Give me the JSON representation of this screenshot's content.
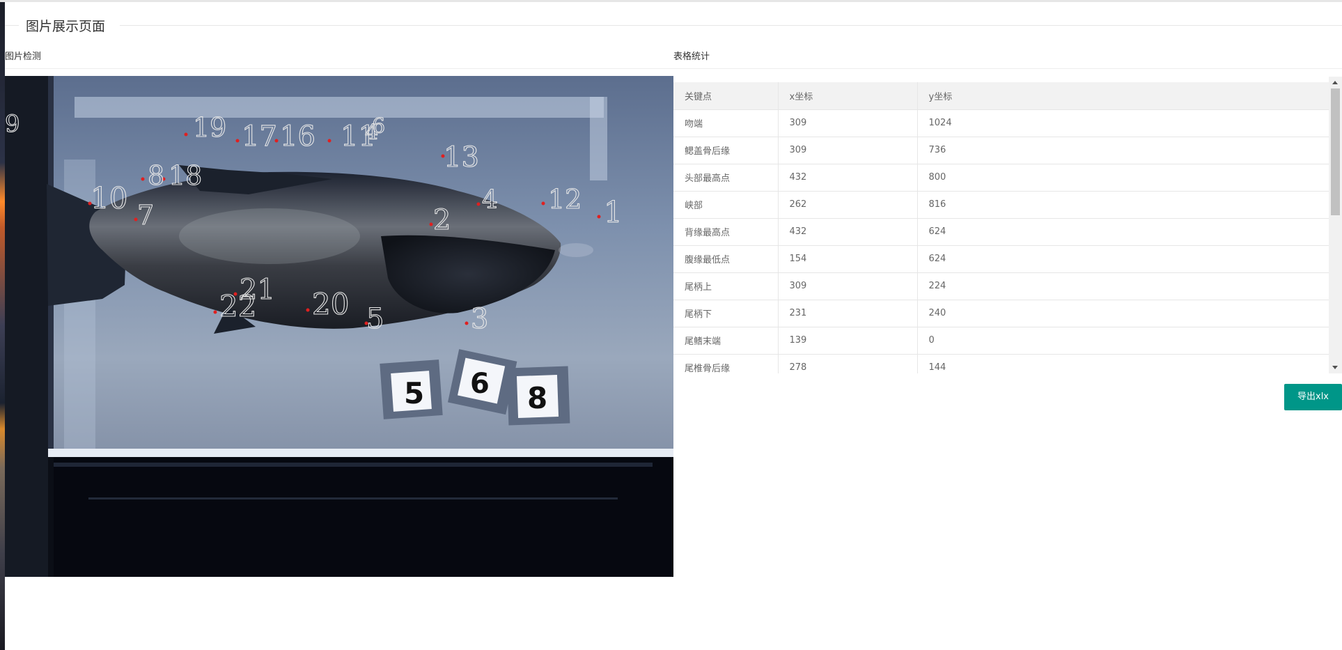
{
  "page": {
    "title": "图片展示页面"
  },
  "sections": {
    "detect_label": "图片检测",
    "stats_label": "表格统计"
  },
  "image": {
    "keypoint_labels": [
      "9",
      "19",
      "17",
      "16",
      "11",
      "4",
      "6",
      "13",
      "8",
      "18",
      "10",
      "7",
      "4",
      "2",
      "12",
      "1",
      "21",
      "22",
      "20",
      "5",
      "3"
    ],
    "tag_numbers": [
      "5",
      "6",
      "8"
    ],
    "marker_color": "#e02020"
  },
  "table": {
    "headers": [
      "关键点",
      "x坐标",
      "y坐标"
    ],
    "rows": [
      [
        "吻端",
        "309",
        "1024"
      ],
      [
        "鳃盖骨后缘",
        "309",
        "736"
      ],
      [
        "头部最高点",
        "432",
        "800"
      ],
      [
        "峡部",
        "262",
        "816"
      ],
      [
        "背缘最高点",
        "432",
        "624"
      ],
      [
        "腹缘最低点",
        "154",
        "624"
      ],
      [
        "尾柄上",
        "309",
        "224"
      ],
      [
        "尾柄下",
        "231",
        "240"
      ],
      [
        "尾鳍末端",
        "139",
        "0"
      ],
      [
        "尾椎骨后缘",
        "278",
        "144"
      ]
    ]
  },
  "export": {
    "label": "导出xlx"
  },
  "colors": {
    "accent": "#009688",
    "header_bg": "#f2f2f2"
  }
}
